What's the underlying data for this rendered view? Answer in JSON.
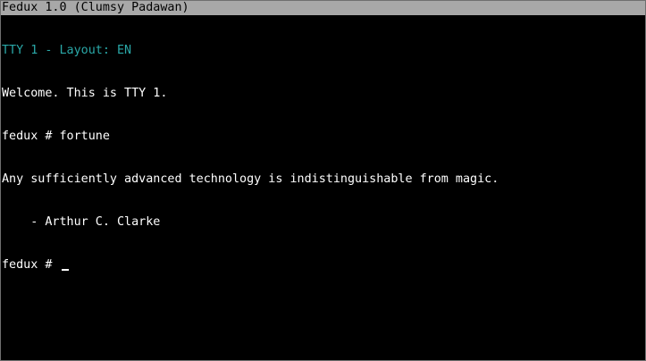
{
  "window": {
    "title": "Fedux 1.0 (Clumsy Padawan)"
  },
  "tty": {
    "header": "TTY 1 - Layout: EN",
    "welcome": "Welcome. This is TTY 1.",
    "command_line": "fedux # fortune",
    "quote_line_1": "Any sufficiently advanced technology is indistinguishable from magic.",
    "quote_line_2": "    - Arthur C. Clarke",
    "prompt": "fedux # "
  },
  "colors": {
    "titlebar_bg": "#a8a8a8",
    "header_text": "#2aa8a8",
    "text": "#ffffff",
    "background": "#000000"
  }
}
